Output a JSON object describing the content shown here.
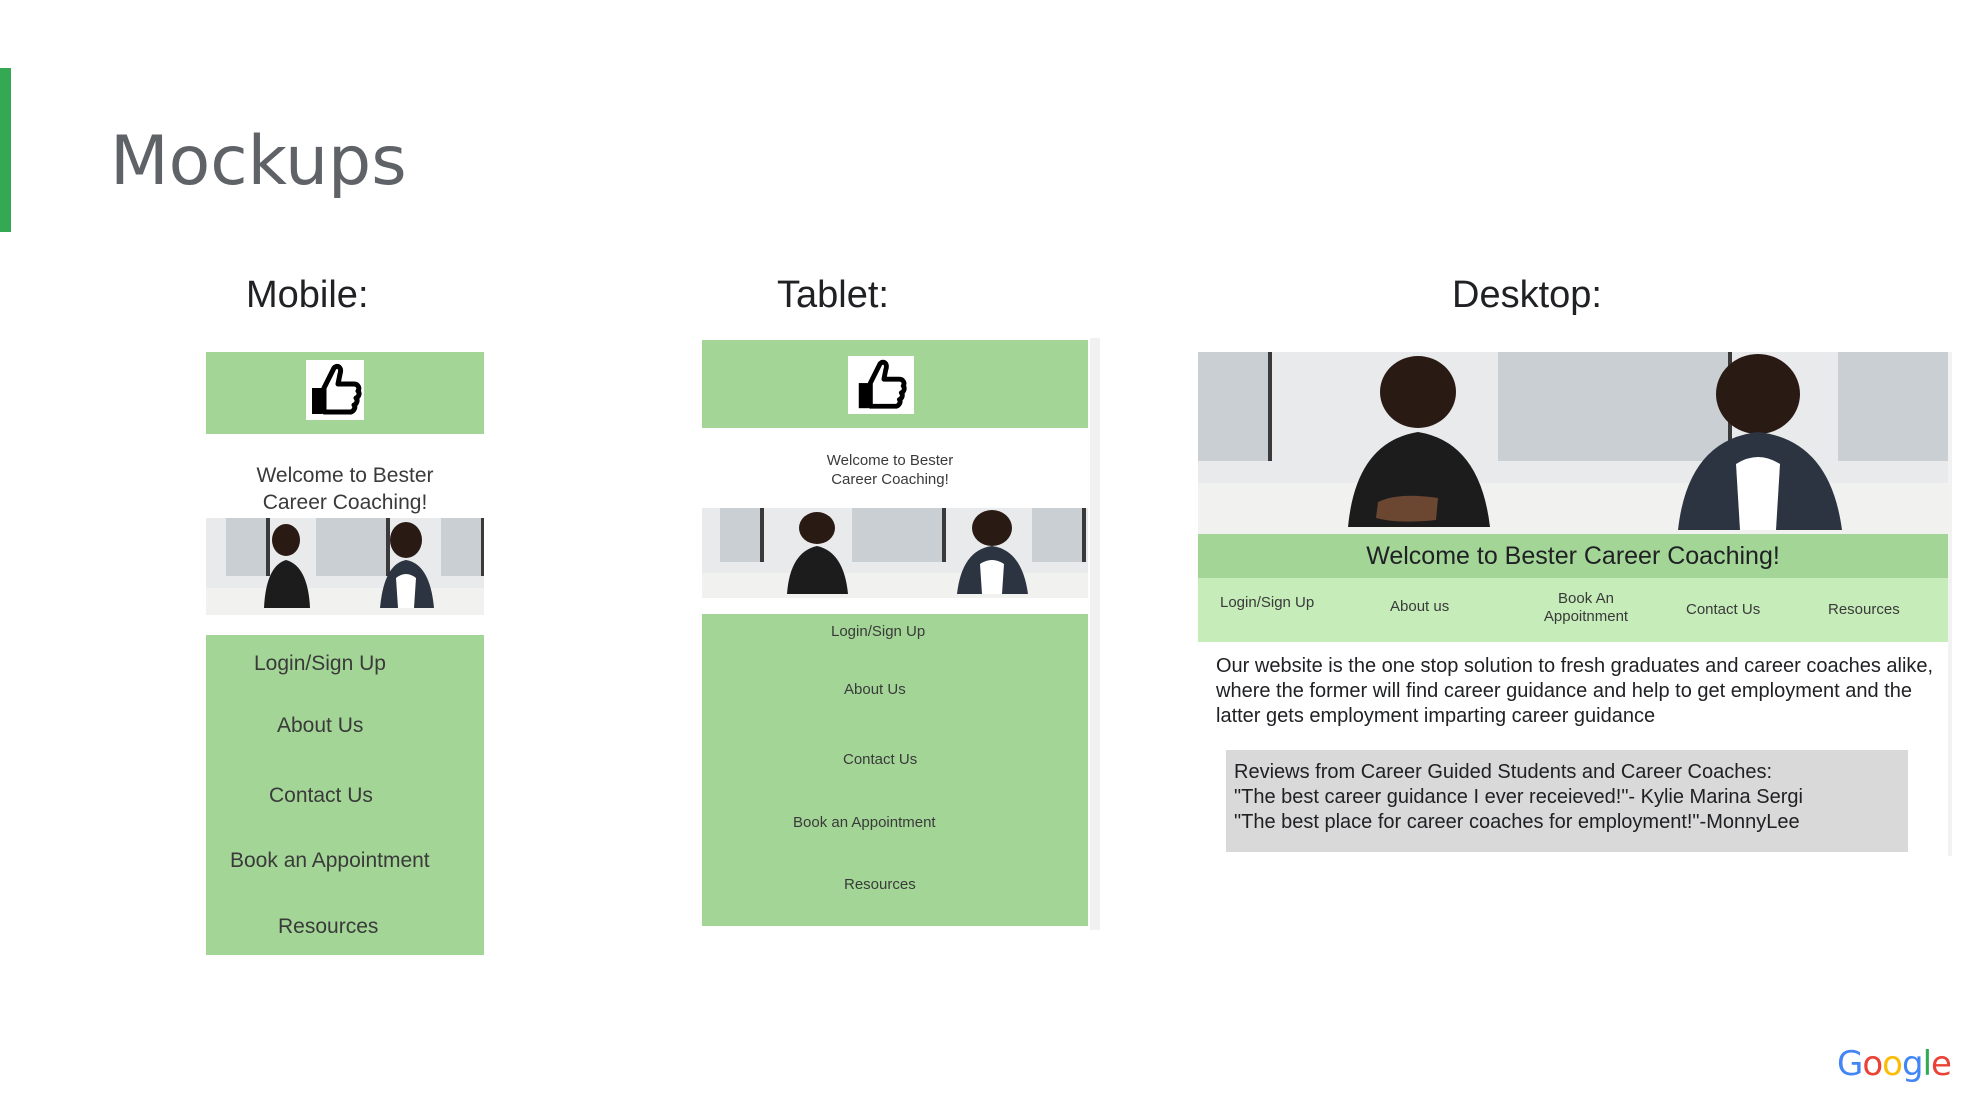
{
  "slide": {
    "title": "Mockups",
    "labels": {
      "mobile": "Mobile:",
      "tablet": "Tablet:",
      "desktop": "Desktop:"
    }
  },
  "mobile": {
    "welcome": [
      "Welcome to Bester",
      "Career Coaching!"
    ],
    "nav": [
      "Login/Sign Up",
      "About Us",
      "Contact Us",
      "Book an Appointment",
      "Resources"
    ]
  },
  "tablet": {
    "welcome": [
      "Welcome to Bester",
      "Career Coaching!"
    ],
    "nav": [
      "Login/Sign Up",
      "About Us",
      "Contact Us",
      "Book an Appointment",
      "Resources"
    ]
  },
  "desktop": {
    "title": "Welcome to Bester Career Coaching!",
    "nav": [
      "Login/Sign Up",
      "About us",
      "Book An",
      "Appoitnment",
      "Contact Us",
      "Resources"
    ],
    "about": "Our website is the one stop solution to fresh graduates and career coaches alike, where the former will find career guidance and help to get employment and the latter gets employment imparting career guidance",
    "reviews": [
      "Reviews from Career Guided Students and Career Coaches:",
      "\"The best career guidance I ever receieved!\"- Kylie Marina Sergi",
      "\"The best place for career coaches for employment!\"-MonnyLee"
    ]
  },
  "branding": {
    "logo_text": "Google"
  },
  "colors": {
    "accent_bar": "#34a853",
    "header_green": "#a3d696",
    "nav_light_green": "#c5ecb9",
    "review_box": "#d9d9d9"
  }
}
